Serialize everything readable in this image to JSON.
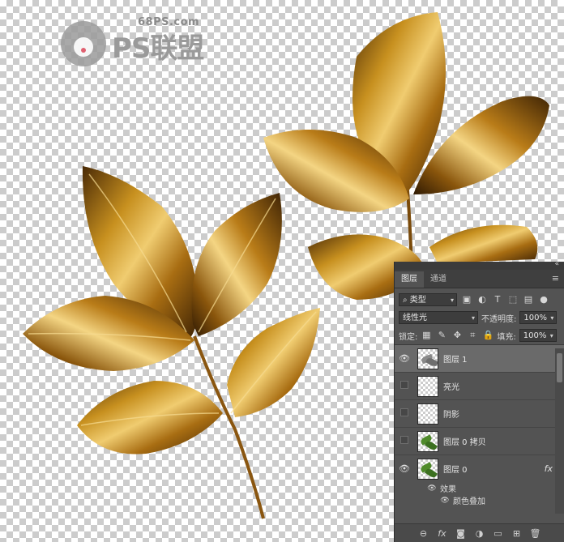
{
  "watermark": {
    "site": "68PS.com",
    "logo_text": "PS联盟"
  },
  "panel": {
    "tabs": [
      "图层",
      "通道"
    ],
    "filter_label": "类型",
    "blend_mode": "线性光",
    "opacity_label": "不透明度:",
    "opacity_value": "100%",
    "lock_label": "锁定:",
    "fill_label": "填充:",
    "fill_value": "100%",
    "layers": [
      {
        "name": "图层 1",
        "visible": true,
        "selected": true
      },
      {
        "name": "亮光",
        "visible": false,
        "selected": false
      },
      {
        "name": "阴影",
        "visible": false,
        "selected": false
      },
      {
        "name": "图层 0 拷贝",
        "visible": false,
        "selected": false
      },
      {
        "name": "图层 0",
        "visible": true,
        "selected": false,
        "fx": "fx"
      }
    ],
    "effects_label": "效果",
    "effect_items": [
      "颜色叠加"
    ]
  },
  "colors": {
    "gold_dark": "#3f2405",
    "gold_mid": "#9a6410",
    "gold_light": "#f2d07a",
    "panel_bg": "#535353"
  }
}
